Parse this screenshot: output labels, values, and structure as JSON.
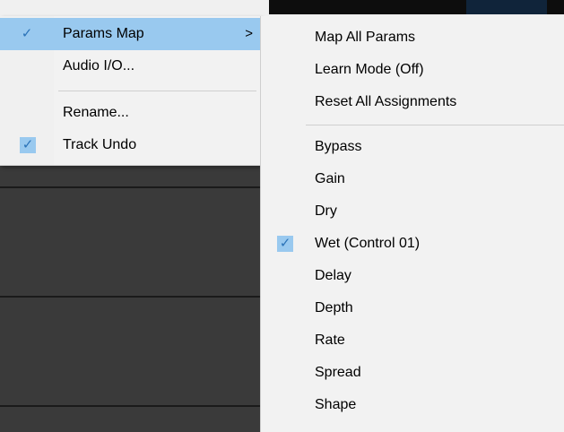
{
  "main_menu": {
    "items": [
      {
        "label": "Params Map",
        "checked": true,
        "highlighted": true,
        "submenu": true,
        "arrow": ">"
      },
      {
        "label": "Audio I/O...",
        "checked": false
      },
      {
        "label": "Rename...",
        "checked": false
      },
      {
        "label": "Track Undo",
        "checked": true
      }
    ],
    "check_glyph": "✓"
  },
  "submenu": {
    "items": [
      {
        "label": "Map All Params"
      },
      {
        "label": "Learn Mode (Off)"
      },
      {
        "label": "Reset All Assignments"
      },
      {
        "label": "Bypass"
      },
      {
        "label": "Gain"
      },
      {
        "label": "Dry"
      },
      {
        "label": "Wet (Control 01)",
        "checked": true
      },
      {
        "label": "Delay"
      },
      {
        "label": "Depth"
      },
      {
        "label": "Rate"
      },
      {
        "label": "Spread"
      },
      {
        "label": "Shape"
      }
    ]
  },
  "colors": {
    "highlight": "#99c9ef",
    "check": "#2b73b8",
    "menu_bg": "#f2f2f2",
    "app_bg": "#3a3a3a"
  }
}
